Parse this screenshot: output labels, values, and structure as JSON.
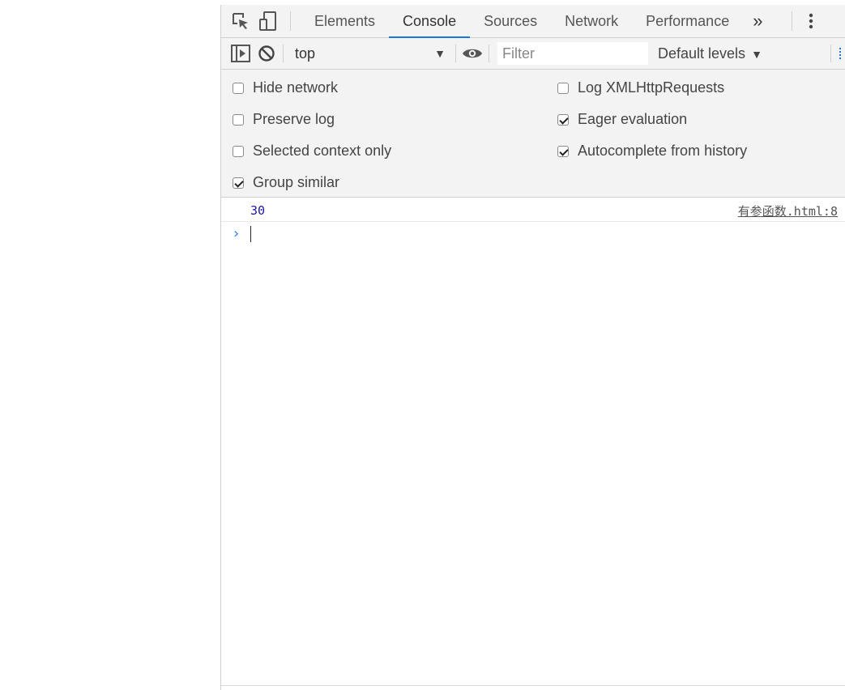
{
  "tabbar": {
    "tabs": [
      {
        "label": "Elements",
        "active": false
      },
      {
        "label": "Console",
        "active": true
      },
      {
        "label": "Sources",
        "active": false
      },
      {
        "label": "Network",
        "active": false
      },
      {
        "label": "Performance",
        "active": false
      }
    ],
    "more_label": "»",
    "icons": [
      "inspect-element-icon",
      "device-toolbar-icon",
      "kebab-menu-icon"
    ]
  },
  "toolbar": {
    "context_value": "top",
    "context_arrow": "▼",
    "filter_placeholder": "Filter",
    "filter_value": "",
    "levels_label": "Default levels",
    "levels_arrow": "▼",
    "icons": [
      "sidebar-toggle-icon",
      "clear-console-icon",
      "eye-icon"
    ]
  },
  "settings": {
    "left": [
      {
        "label": "Hide network",
        "checked": false
      },
      {
        "label": "Preserve log",
        "checked": false
      },
      {
        "label": "Selected context only",
        "checked": false
      },
      {
        "label": "Group similar",
        "checked": true
      }
    ],
    "right": [
      {
        "label": "Log XMLHttpRequests",
        "checked": false
      },
      {
        "label": "Eager evaluation",
        "checked": true
      },
      {
        "label": "Autocomplete from history",
        "checked": true
      }
    ]
  },
  "console": {
    "messages": [
      {
        "value": "30",
        "source": "有参函数.html:8"
      }
    ],
    "prompt_symbol": "›"
  },
  "colors": {
    "accent": "#1a73e8",
    "number_value": "#1a1aa6",
    "prompt": "#367cf1",
    "panel_bg": "#f3f3f3"
  }
}
